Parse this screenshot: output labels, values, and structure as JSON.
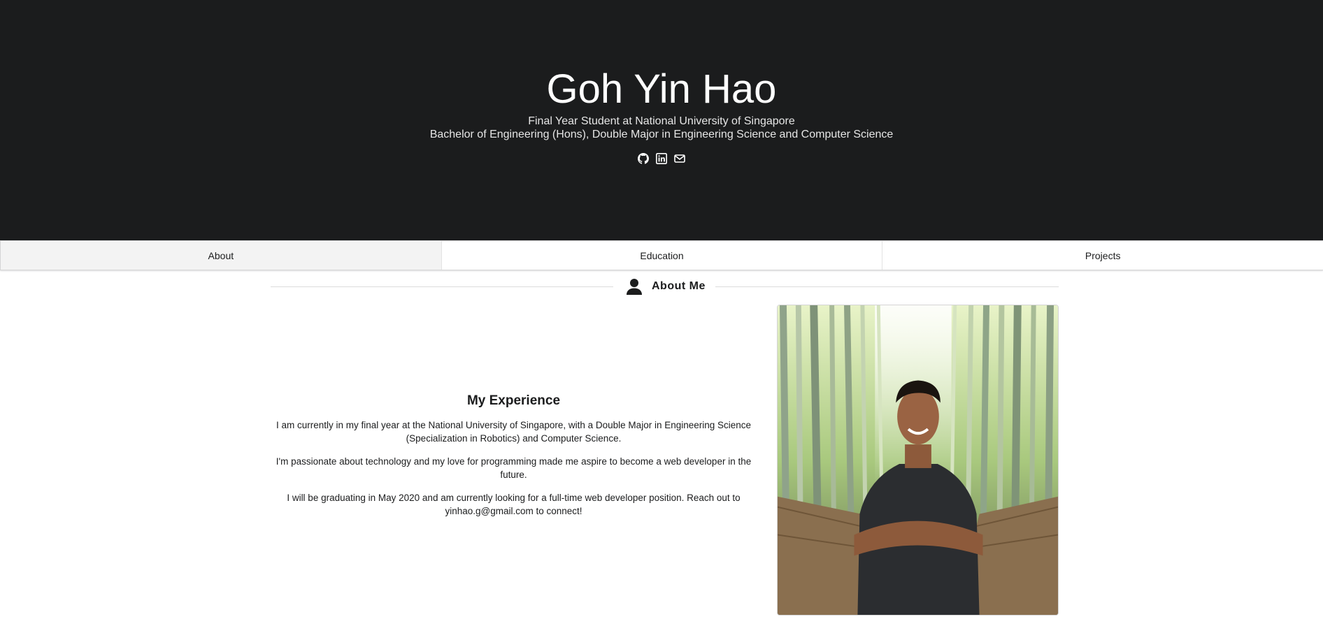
{
  "header": {
    "name": "Goh Yin Hao",
    "subtitle_1": "Final Year Student at National University of Singapore",
    "subtitle_2": "Bachelor of Engineering (Hons), Double Major in Engineering Science and Computer Science",
    "social_icons": [
      "github-icon",
      "linkedin-icon",
      "envelope-icon"
    ]
  },
  "tabs": [
    {
      "label": "About",
      "active": true
    },
    {
      "label": "Education",
      "active": false
    },
    {
      "label": "Projects",
      "active": false
    }
  ],
  "section": {
    "icon": "user-icon",
    "title": "About Me"
  },
  "experience": {
    "title": "My Experience",
    "paragraphs": [
      "I am currently in my final year at the National University of Singapore, with a Double Major in Engineering Science (Specialization in Robotics) and Computer Science.",
      "I'm passionate about technology and my love for programming made me aspire to become a web developer in the future.",
      "I will be graduating in May 2020 and am currently looking for a full-time web developer position. Reach out to yinhao.g@gmail.com to connect!"
    ]
  },
  "colors": {
    "hero_background": "#1b1c1d",
    "active_tab_background": "#f3f3f3"
  }
}
